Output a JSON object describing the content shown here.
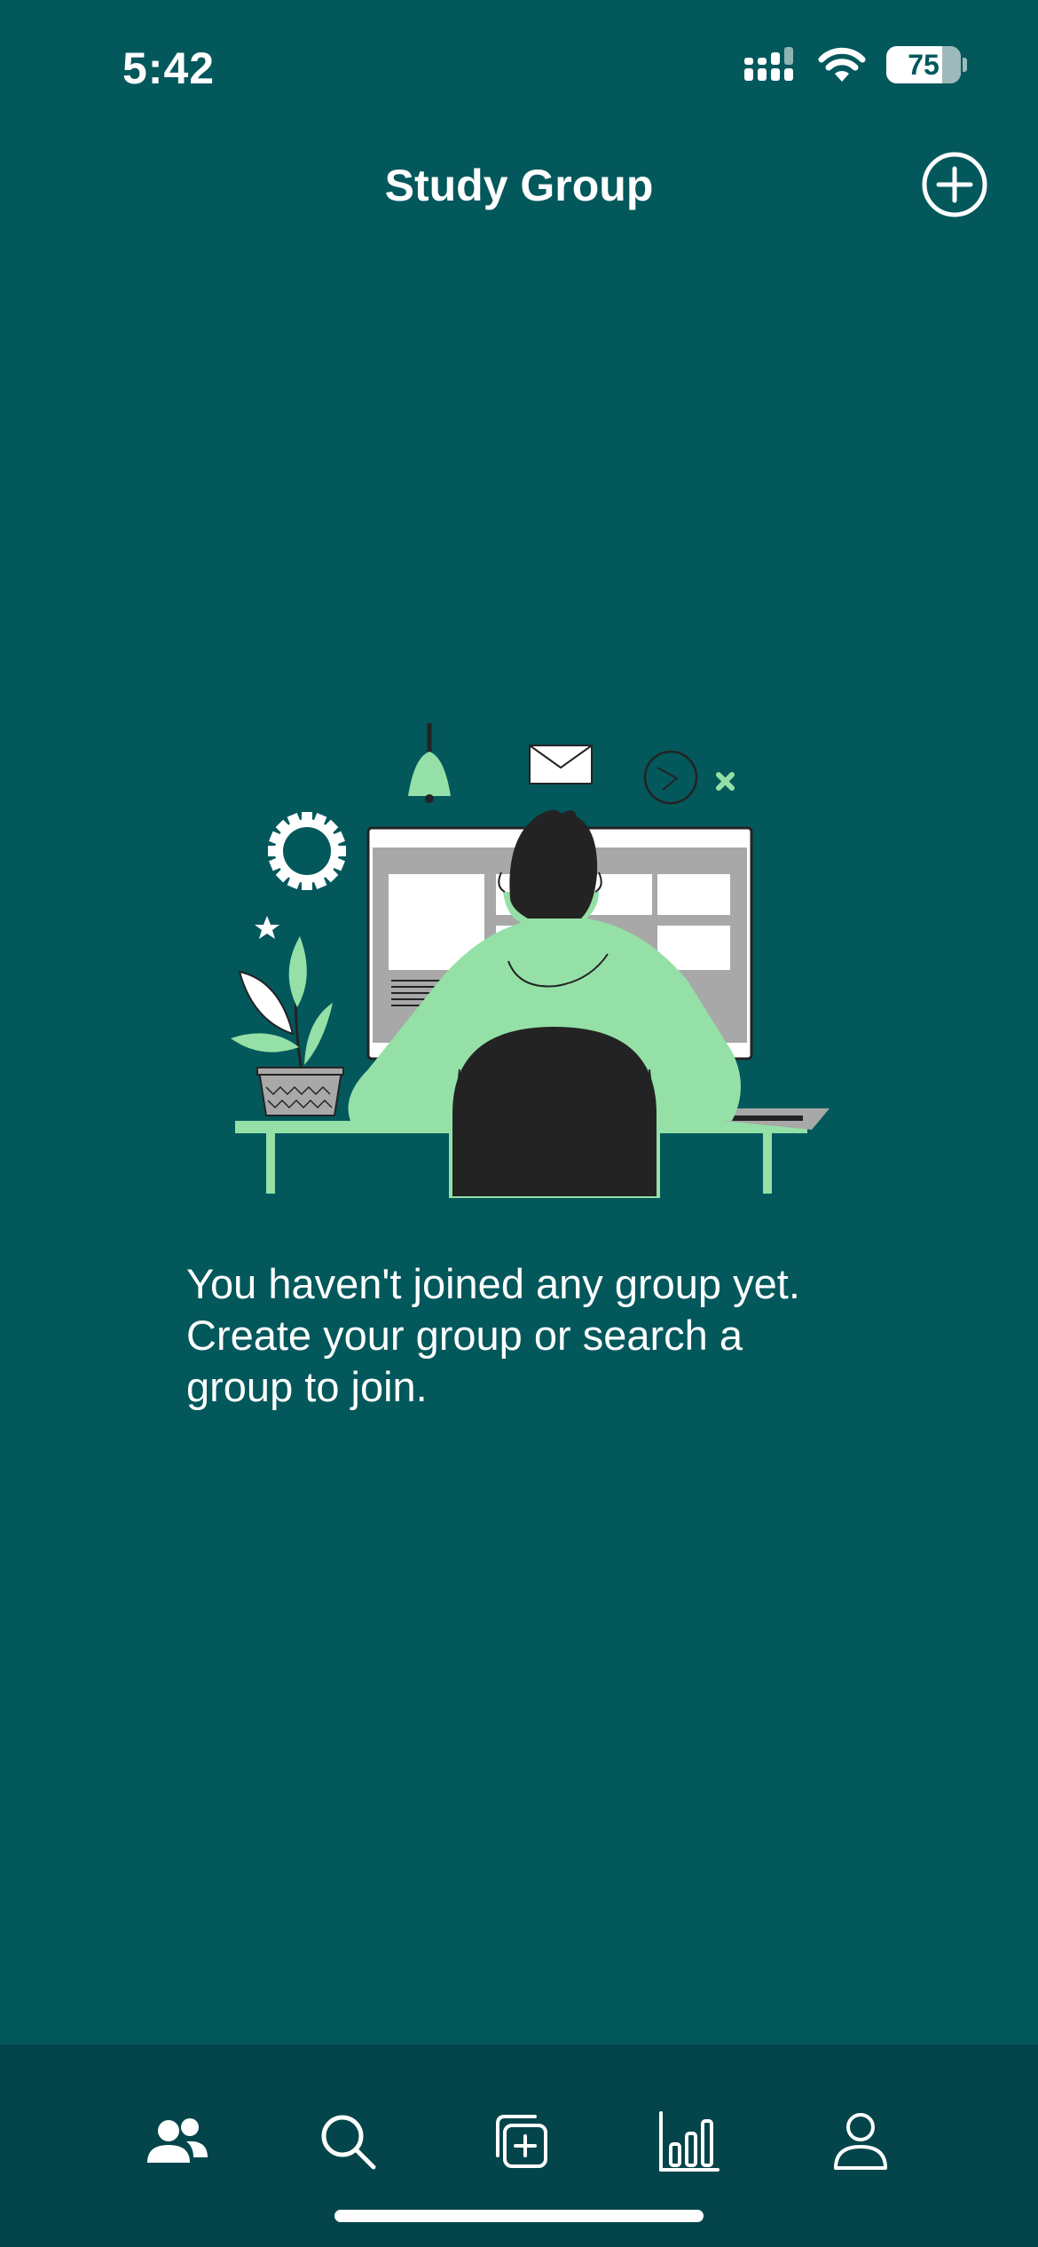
{
  "status_bar": {
    "time": "5:42",
    "battery_level": 75,
    "battery_text": "75",
    "icons": [
      "cellular-signal-icon",
      "wifi-icon",
      "battery-icon"
    ]
  },
  "header": {
    "title": "Study Group",
    "add_icon": "plus-circle-icon"
  },
  "empty_state": {
    "illustration": "person-at-computer-illustration",
    "message": "You haven't joined any group yet. Create your group or search a group to join."
  },
  "tab_bar": {
    "tabs": [
      {
        "icon": "groups-icon",
        "active": true
      },
      {
        "icon": "search-icon",
        "active": false
      },
      {
        "icon": "add-square-icon",
        "active": false
      },
      {
        "icon": "stats-chart-icon",
        "active": false
      },
      {
        "icon": "profile-icon",
        "active": false
      }
    ]
  },
  "colors": {
    "background": "#03585c",
    "tab_bar": "#03454a",
    "accent_green": "#94e0a6",
    "dark": "#232323"
  }
}
